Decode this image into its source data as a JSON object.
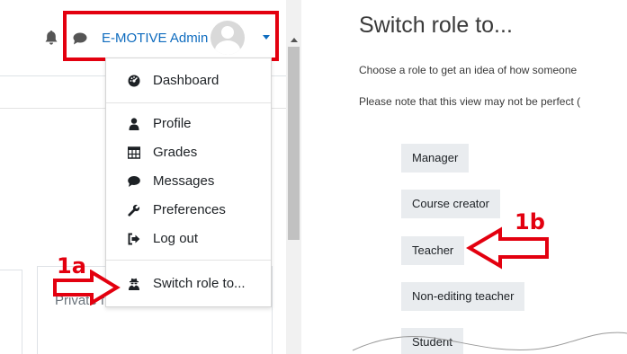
{
  "navbar": {
    "user_name": "E-MOTIVE Admin"
  },
  "user_menu": {
    "items": [
      {
        "label": "Dashboard",
        "icon": "dashboard-icon"
      },
      {
        "label": "Profile",
        "icon": "user-icon"
      },
      {
        "label": "Grades",
        "icon": "table-icon"
      },
      {
        "label": "Messages",
        "icon": "chat-icon"
      },
      {
        "label": "Preferences",
        "icon": "wrench-icon"
      },
      {
        "label": "Log out",
        "icon": "sign-out-icon"
      },
      {
        "label": "Switch role to...",
        "icon": "user-secret-icon"
      }
    ]
  },
  "background_block": {
    "label": "Private files"
  },
  "callouts": {
    "left": "1a",
    "right": "1b"
  },
  "switch_role_page": {
    "title": "Switch role to...",
    "intro": "Choose a role to get an idea of how someone",
    "note": "Please note that this view may not be perfect (",
    "roles": [
      "Manager",
      "Course creator",
      "Teacher",
      "Non-editing teacher",
      "Student"
    ]
  },
  "colors": {
    "highlight_red": "#e3000f",
    "link_blue": "#0f6cbf",
    "button_gray": "#e9ecef"
  }
}
